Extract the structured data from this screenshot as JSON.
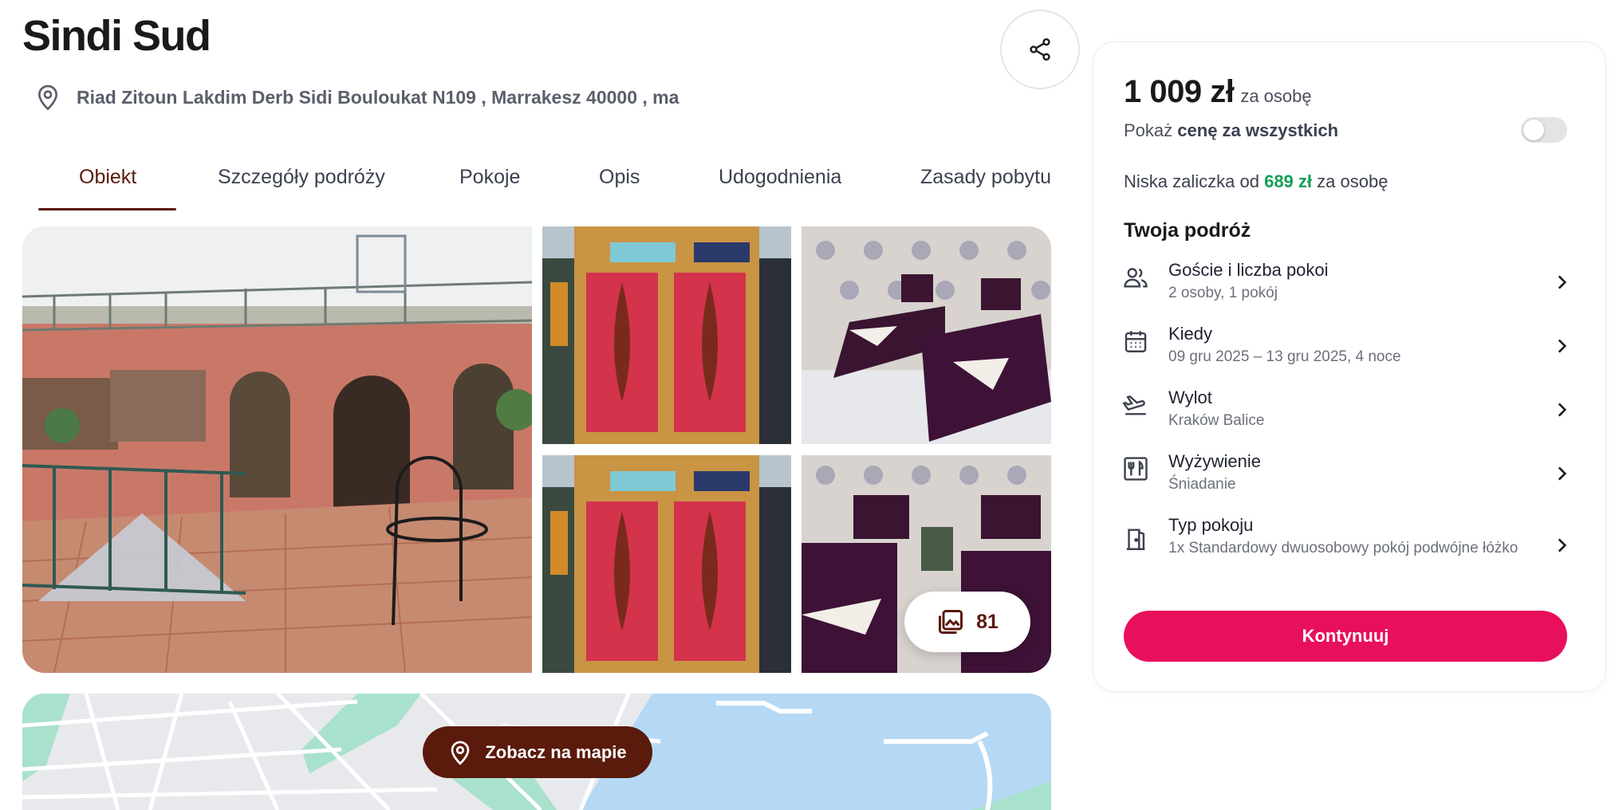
{
  "hotel": {
    "name": "Sindi Sud",
    "address": "Riad Zitoun Lakdim Derb Sidi Bouloukat N109 , Marrakesz 40000 , ma"
  },
  "tabs": [
    {
      "label": "Obiekt",
      "active": true
    },
    {
      "label": "Szczegóły podróży"
    },
    {
      "label": "Pokoje"
    },
    {
      "label": "Opis"
    },
    {
      "label": "Udogodnienia"
    },
    {
      "label": "Zasady pobytu"
    }
  ],
  "gallery": {
    "photo_count": "81"
  },
  "map": {
    "button_label": "Zobacz na mapie"
  },
  "booking": {
    "price": "1 009 zł",
    "price_suffix": "za osobę",
    "show_all_prefix": "Pokaż",
    "show_all_bold": "cenę za wszystkich",
    "deposit_prefix": "Niska zaliczka od",
    "deposit_amount": "689 zł",
    "deposit_suffix": "za osobę",
    "trip_title": "Twoja podróż",
    "rows": [
      {
        "icon": "guests-icon",
        "label": "Goście i liczba pokoi",
        "value": "2 osoby, 1 pokój"
      },
      {
        "icon": "calendar-icon",
        "label": "Kiedy",
        "value": "09 gru 2025 – 13 gru 2025, 4 noce"
      },
      {
        "icon": "plane-departure-icon",
        "label": "Wylot",
        "value": "Kraków Balice"
      },
      {
        "icon": "fork-knife-icon",
        "label": "Wyżywienie",
        "value": "Śniadanie"
      },
      {
        "icon": "door-icon",
        "label": "Typ pokoju",
        "value": "1x Standardowy dwuosobowy pokój podwójne łóżko"
      }
    ],
    "continue_label": "Kontynuuj"
  },
  "colors": {
    "brand_dark": "#5a1a0c",
    "cta": "#e8105d",
    "deposit_green": "#10a053"
  }
}
